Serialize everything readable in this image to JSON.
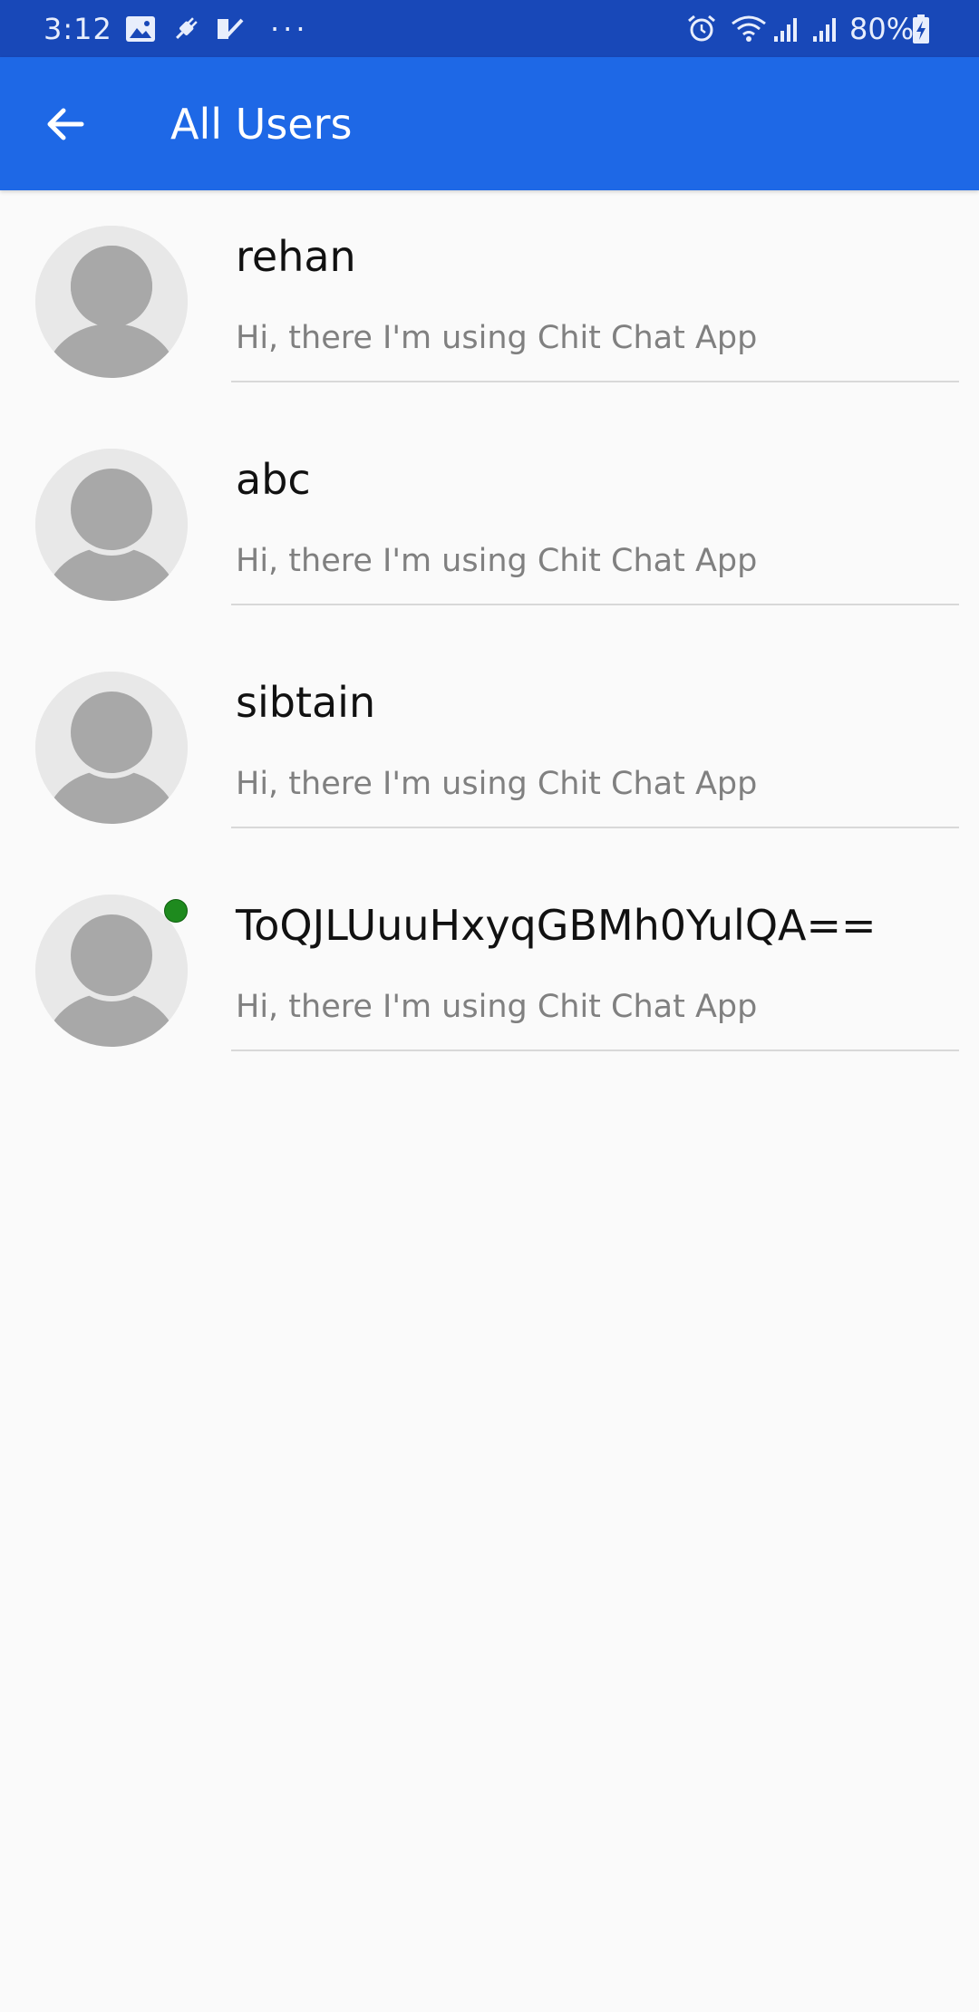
{
  "status_bar": {
    "time": "3:12",
    "battery_percent": "80%",
    "more_indicator": "···",
    "icons": [
      "photo-icon",
      "usb-plug-icon",
      "check-icon",
      "more-icon",
      "alarm-icon",
      "wifi-icon",
      "signal-icon",
      "signal-icon",
      "battery-charging-icon"
    ],
    "bg_color": "#1848b8"
  },
  "app_bar": {
    "title": "All Users",
    "back_icon": "arrow-back-icon",
    "bg_color": "#1e68e6"
  },
  "users": [
    {
      "name": "rehan",
      "status": "Hi, there I'm using Chit Chat App",
      "online": false
    },
    {
      "name": "abc",
      "status": "Hi, there I'm using Chit Chat App",
      "online": false
    },
    {
      "name": "sibtain",
      "status": "Hi, there I'm using Chit Chat App",
      "online": false
    },
    {
      "name": "ToQJLUuuHxyqGBMh0YulQA==",
      "status": "Hi, there I'm using Chit Chat App",
      "online": true
    }
  ],
  "colors": {
    "online_indicator": "#1e8a1e",
    "avatar_bg": "#e8e8e8",
    "avatar_figure": "#a8a8a8"
  }
}
